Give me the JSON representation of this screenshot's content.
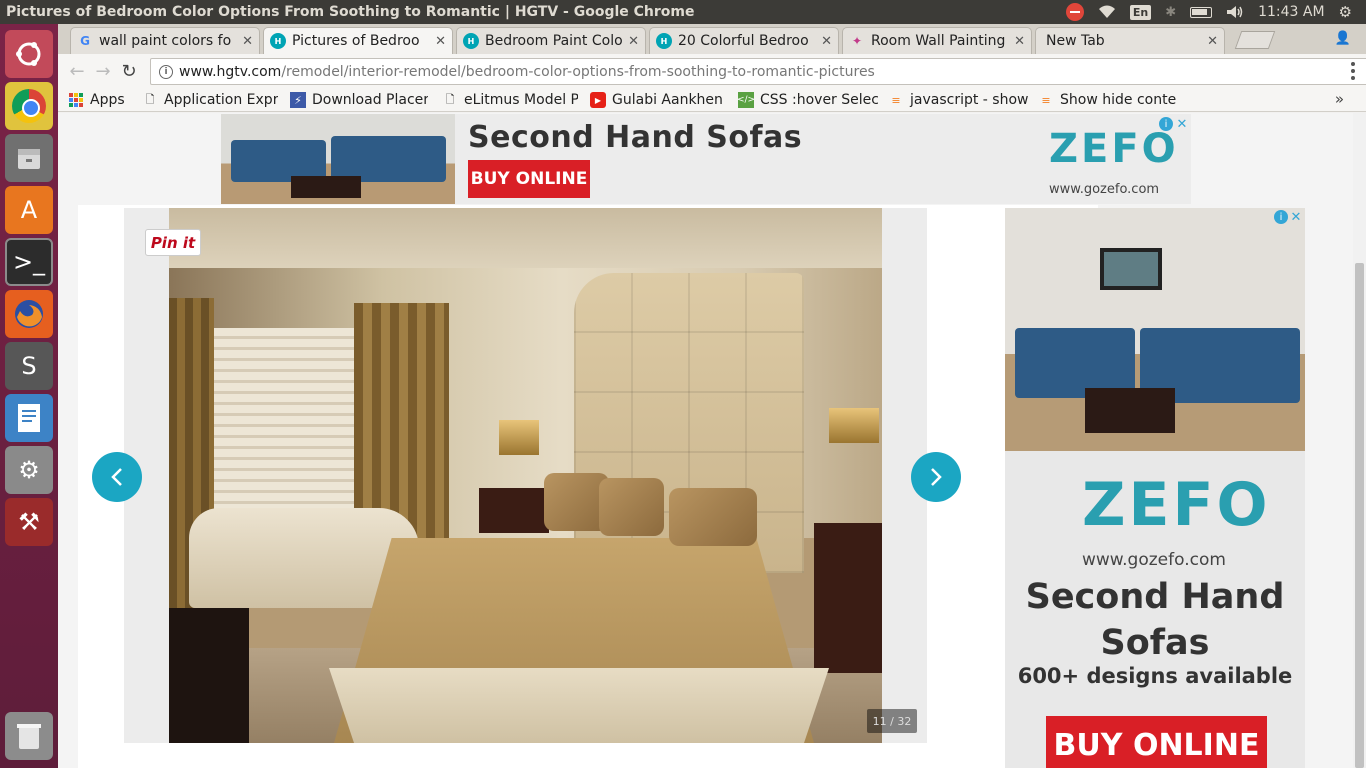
{
  "window": {
    "title": "Pictures of Bedroom Color Options From Soothing to Romantic | HGTV - Google Chrome"
  },
  "system": {
    "lang": "En",
    "time": "11:43 AM"
  },
  "tabs": [
    {
      "label": "wall paint colors fo",
      "favicon": "google-g"
    },
    {
      "label": "Pictures of Bedroo",
      "favicon": "hgtv"
    },
    {
      "label": "Bedroom Paint Colo",
      "favicon": "hgtv"
    },
    {
      "label": "20 Colorful Bedroo",
      "favicon": "hgtv"
    },
    {
      "label": "Room Wall Painting",
      "favicon": "decor"
    },
    {
      "label": "New Tab",
      "favicon": ""
    }
  ],
  "address": {
    "host": "www.hgtv.com",
    "path": "/remodel/interior-remodel/bedroom-color-options-from-soothing-to-romantic-pictures"
  },
  "bookmarks": [
    {
      "label": "Apps",
      "icon": "apps-grid-icon"
    },
    {
      "label": "Application Expr",
      "icon": "page-icon"
    },
    {
      "label": "Download Placer",
      "icon": "bolt-icon"
    },
    {
      "label": "eLitmus Model P",
      "icon": "page-icon"
    },
    {
      "label": "Gulabi Aankhen",
      "icon": "youtube-icon"
    },
    {
      "label": "CSS :hover Select",
      "icon": "code-icon"
    },
    {
      "label": "javascript - show",
      "icon": "stackoverflow-icon"
    },
    {
      "label": "Show hide conte",
      "icon": "stackoverflow-icon"
    }
  ],
  "top_ad": {
    "headline": "Second Hand Sofas",
    "button": "BUY ONLINE",
    "brand": "ZEFO",
    "url": "www.gozefo.com"
  },
  "gallery": {
    "pin_label": "Pin it",
    "counter": "11 / 32"
  },
  "side_ad": {
    "brand": "ZEFO",
    "url": "www.gozefo.com",
    "headline_line1": "Second Hand",
    "headline_line2": "Sofas",
    "tagline": "600+ designs available",
    "button": "BUY ONLINE"
  },
  "colors": {
    "accent": "#1ba6c3",
    "ad_red": "#d91f26",
    "zefo_teal": "#2a9fb0",
    "launcher": "#6b2140"
  }
}
